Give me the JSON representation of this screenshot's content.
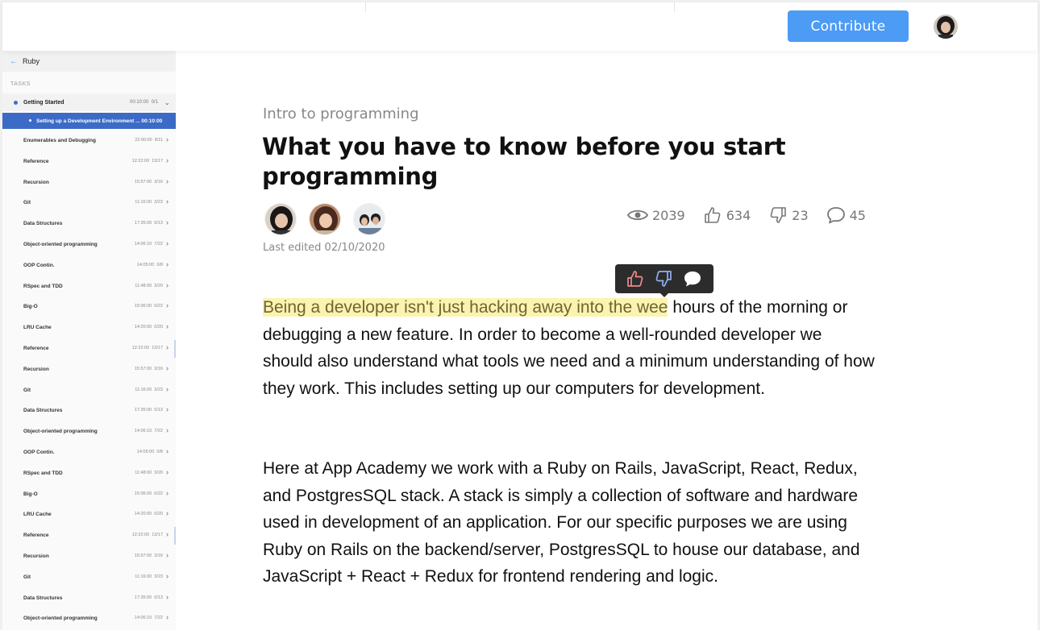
{
  "header": {
    "contribute_label": "Contribute"
  },
  "sidebar": {
    "back_label": "Ruby",
    "section_label": "TASKS",
    "group": {
      "label": "Getting Started",
      "time": "00:10:00",
      "count": "0/1"
    },
    "active": {
      "label": "Setting up a Development Environment ... 00:10:00"
    },
    "tasks": [
      {
        "label": "Enumerables and Debugging",
        "time": "22:00:00",
        "count": "8/11"
      },
      {
        "label": "Reference",
        "time": "12:22:00",
        "count": "13/17"
      },
      {
        "label": "Recursion",
        "time": "15:57:00",
        "count": "3/16"
      },
      {
        "label": "Git",
        "time": "11:16:00",
        "count": "3/23"
      },
      {
        "label": "Data Structures",
        "time": "17:35:00",
        "count": "0/13"
      },
      {
        "label": "Object-oriented programming",
        "time": "14:06:10",
        "count": "7/22"
      },
      {
        "label": "OOP Contin.",
        "time": "14:05:00",
        "count": "0/8"
      },
      {
        "label": "RSpec and TDD",
        "time": "11:48:00",
        "count": "3/20"
      },
      {
        "label": "Big-O",
        "time": "15:06:00",
        "count": "0/22"
      },
      {
        "label": "LRU Cache",
        "time": "14:20:00",
        "count": "0/20"
      },
      {
        "label": "Reference",
        "time": "12:22:00",
        "count": "13/17"
      },
      {
        "label": "Recursion",
        "time": "15:57:00",
        "count": "3/16"
      },
      {
        "label": "Git",
        "time": "11:16:00",
        "count": "3/23"
      },
      {
        "label": "Data Structures",
        "time": "17:35:00",
        "count": "0/13"
      },
      {
        "label": "Object-oriented programming",
        "time": "14:06:10",
        "count": "7/22"
      },
      {
        "label": "OOP Contin.",
        "time": "14:05:00",
        "count": "0/8"
      },
      {
        "label": "RSpec and TDD",
        "time": "11:48:00",
        "count": "3/20"
      },
      {
        "label": "Big-O",
        "time": "15:06:00",
        "count": "0/22"
      },
      {
        "label": "LRU Cache",
        "time": "14:20:00",
        "count": "0/20"
      },
      {
        "label": "Reference",
        "time": "12:22:00",
        "count": "13/17"
      },
      {
        "label": "Recursion",
        "time": "15:57:00",
        "count": "3/16"
      },
      {
        "label": "Git",
        "time": "11:16:00",
        "count": "3/23"
      },
      {
        "label": "Data Structures",
        "time": "17:35:00",
        "count": "0/13"
      },
      {
        "label": "Object-oriented programming",
        "time": "14:06:10",
        "count": "7/22"
      }
    ]
  },
  "article": {
    "breadcrumb": "Intro to programming",
    "title": "What you have to know before you start programming",
    "last_edited": "Last edited 02/10/2020",
    "stats": {
      "views": "2039",
      "likes": "634",
      "dislikes": "23",
      "comments": "45"
    },
    "p1_highlight": "Being a developer isn't just hacking away into the wee",
    "p1_rest": " hours of the morning or debugging a new feature. In order to become a well-rounded developer we should also understand what tools we need and a minimum understanding of how they work. This includes setting up our computers for development.",
    "p2": "Here at App Academy we work with a Ruby on Rails, JavaScript, React, Redux, and PostgresSQL stack. A stack is simply a collection of software and hardware used in development of an application. For our specific purposes we are using Ruby on Rails on the backend/server, PostgresSQL to house our database, and JavaScript + React + Redux for frontend rendering and logic."
  },
  "colors": {
    "accent": "#4c9bf5",
    "sidebar_active": "#3b6ac7",
    "highlight": "#fbf3b0",
    "like_icon": "#f08a8a",
    "dislike_icon": "#8fb0f5"
  },
  "icons": [
    "back-arrow-icon",
    "chevron-down-icon",
    "chevron-right-icon",
    "eye-icon",
    "thumbs-up-icon",
    "thumbs-down-icon",
    "comment-icon"
  ]
}
